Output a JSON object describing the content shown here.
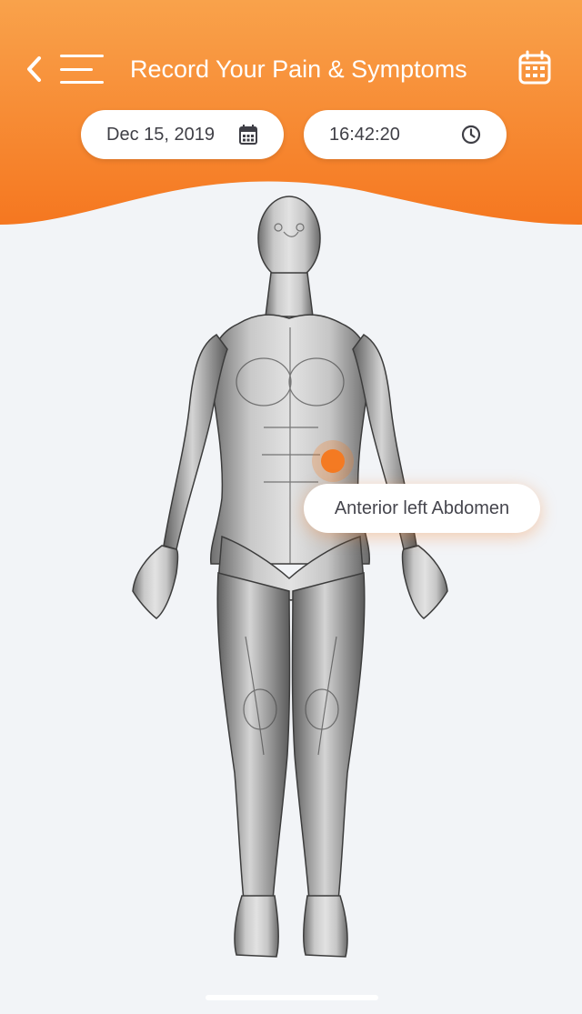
{
  "header": {
    "title": "Record Your Pain & Symptoms",
    "back_icon": "chevron-left-icon",
    "menu_icon": "hamburger-menu-icon",
    "calendar_icon": "calendar-icon",
    "gradient_top": "#f9a24b",
    "gradient_bottom": "#f57720"
  },
  "date_picker": {
    "value": "Dec 15, 2019",
    "icon": "calendar-small-icon"
  },
  "time_picker": {
    "value": "16:42:20",
    "icon": "clock-icon"
  },
  "body_map": {
    "figure": "anatomical-body-front",
    "selected_region": "Anterior left Abdomen",
    "marker_color": "#f47a22"
  }
}
